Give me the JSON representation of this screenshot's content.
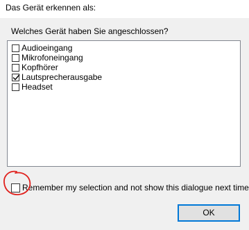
{
  "window": {
    "title": "Das Gerät erkennen als:"
  },
  "dialog": {
    "question": "Welches Gerät haben Sie angeschlossen?",
    "devices": [
      {
        "label": "Audioeingang",
        "checked": false
      },
      {
        "label": "Mikrofoneingang",
        "checked": false
      },
      {
        "label": "Kopfhörer",
        "checked": false
      },
      {
        "label": "Lautsprecherausgabe",
        "checked": true
      },
      {
        "label": "Headset",
        "checked": false
      }
    ],
    "remember_label": "Remember my selection and not show this dialogue next time",
    "remember_checked": false,
    "ok_label": "OK"
  },
  "annotation": {
    "color": "#e0201c"
  },
  "colors": {
    "button_focus_border": "#0078d7",
    "dialog_background": "#f0f0f0"
  }
}
